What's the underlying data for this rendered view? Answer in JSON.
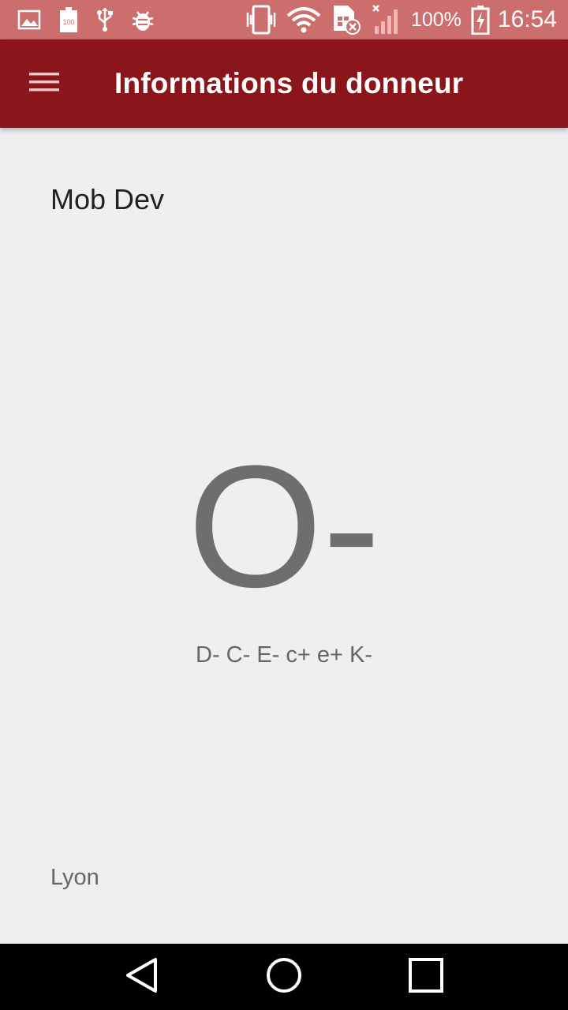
{
  "status_bar": {
    "battery_percent": "100%",
    "time": "16:54",
    "icons": [
      "image-icon",
      "battery-100-icon",
      "usb-icon",
      "bug-icon",
      "vibrate-icon",
      "wifi-icon",
      "sim-error-icon",
      "signal-icon",
      "battery-charging-icon"
    ]
  },
  "app_bar": {
    "title": "Informations du donneur",
    "menu_icon": "hamburger-menu-icon"
  },
  "donor": {
    "name": "Mob Dev",
    "blood_group": "O-",
    "phenotype": "D- C- E- c+ e+ K-",
    "city": "Lyon"
  },
  "nav_bar": {
    "icons": [
      "back-icon",
      "home-icon",
      "recents-icon"
    ]
  },
  "colors": {
    "status_bar": "#cc6e6e",
    "app_bar": "#8a151a",
    "background": "#efeef1",
    "blood_group_text": "#6e6e6e"
  }
}
